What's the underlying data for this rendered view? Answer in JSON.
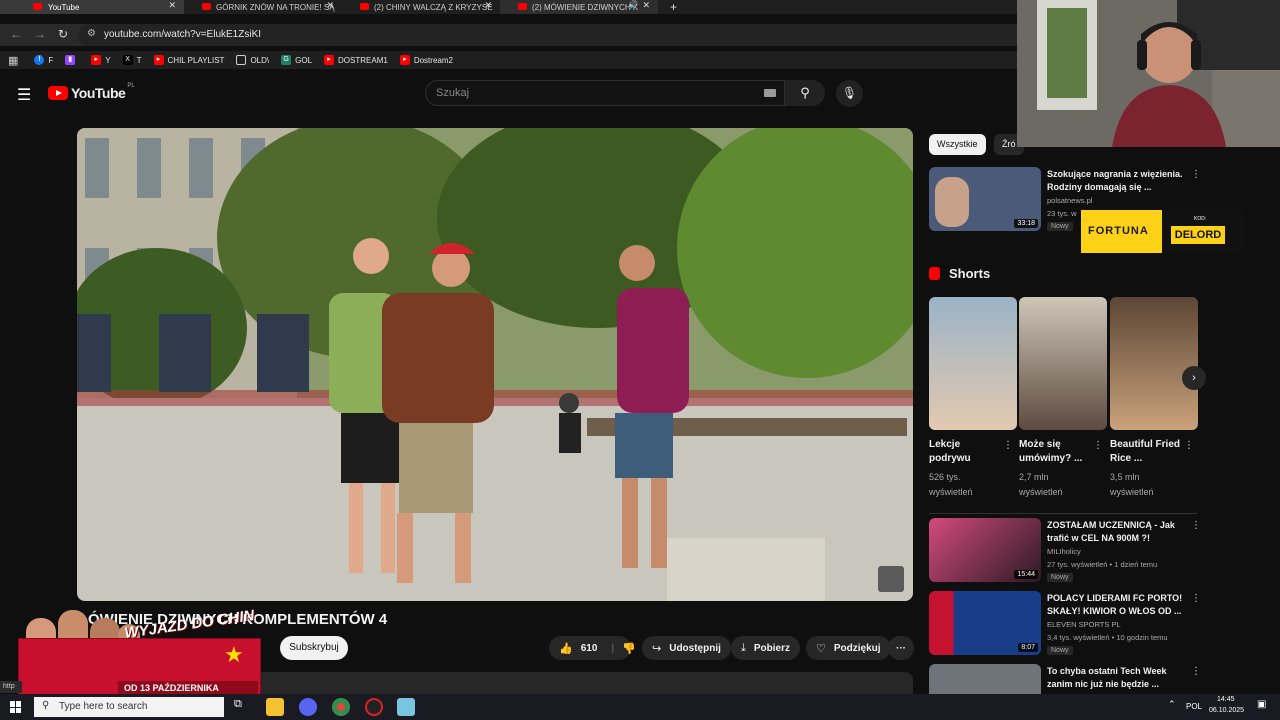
{
  "browser": {
    "tabs": [
      {
        "label": "YouTube",
        "active": true
      },
      {
        "label": "GÓRNIK ZNÓW NA TRONIE! SĄ",
        "active": false
      },
      {
        "label": "(2) CHINY WALCZĄ Z KRYZYSE",
        "active": false
      },
      {
        "label": "(2) MÓWIENIE DZIWNYCH K",
        "active": false
      }
    ],
    "url": "youtube.com/watch?v=ElukE1ZsiKI",
    "bookmarks": [
      {
        "label": "F",
        "icon": "facebook-icon",
        "color": "#1877f2"
      },
      {
        "label": "",
        "icon": "twitch-icon",
        "color": "#9146ff"
      },
      {
        "label": "Y",
        "icon": "youtube-icon",
        "color": "#ff0000"
      },
      {
        "label": "T",
        "icon": "x-icon",
        "color": "#000000"
      },
      {
        "label": "CHIL PLAYLIST",
        "icon": "youtube-icon",
        "color": "#ff0000"
      },
      {
        "label": "OLD\\",
        "icon": "folder-icon",
        "color": "#1f1f1f"
      },
      {
        "label": "GOL",
        "icon": "gol-icon",
        "color": "#1b7f6a"
      },
      {
        "label": "DOSTREAM1",
        "icon": "youtube-icon",
        "color": "#ff0000"
      },
      {
        "label": "Dostream2",
        "icon": "youtube-icon",
        "color": "#ff0000"
      }
    ]
  },
  "youtube": {
    "logo_text": "YouTube",
    "region": "PL",
    "search_placeholder": "Szukaj",
    "video": {
      "title": "ÓWIENIE DZIWNYCH KOMPLEMENTÓW 4",
      "subscribe_label": "Subskrybuj",
      "likes": "610",
      "share_label": "Udostępnij",
      "download_label": "Pobierz",
      "thanks_label": "Podziękuj",
      "more_label": "···"
    },
    "sidebar": {
      "chips": [
        "Wszystkie",
        "Źró"
      ],
      "top_rec": {
        "title": "Szokujące nagrania z więzienia. Rodziny domagają się ...",
        "channel": "polsatnews.pl",
        "meta": "23 tys. w",
        "badge": "Nowy",
        "duration": "33:18"
      },
      "shorts_header": "Shorts",
      "shorts": [
        {
          "title": "Lekcje podrywu",
          "views": "526 tys. wyświetleń"
        },
        {
          "title": "Może się umówimy? ...",
          "views": "2,7 mln wyświetleń"
        },
        {
          "title": "Beautiful Fried Rice ...",
          "views": "3,5 mln wyświetleń"
        }
      ],
      "recs": [
        {
          "title": "ZOSTAŁAM UCZENNICĄ - Jak trafić w CEL NA 900M ?!",
          "channel": "MILIholicy",
          "meta": "27 tys. wyświetleń • 1 dzień temu",
          "badge": "Nowy",
          "duration": "15:44"
        },
        {
          "title": "POLACY LIDERAMI FC PORTO! SKAŁY! KIWIOR O WŁOS OD ...",
          "channel": "ELEVEN SPORTS PL",
          "meta": "3,4 tys. wyświetleń • 10 godzin temu",
          "badge": "Nowy",
          "duration": "8:07"
        },
        {
          "title": "To chyba ostatni Tech Week zanim nic już nie będzie ...",
          "channel": "",
          "meta": "",
          "badge": "",
          "duration": ""
        }
      ]
    }
  },
  "overlays": {
    "promo_title": "WYJAZD DO CHIN",
    "promo_date": "OD 13 PAŹDZIERNIKA",
    "sponsor_word": "FORTUNA",
    "sponsor_code_label": "KOD:",
    "sponsor_code": "DELORD"
  },
  "taskbar": {
    "search_placeholder": "Type here to search",
    "lang": "POL",
    "time": "14:45",
    "date": "06.10.2025"
  },
  "status_hint": "http"
}
